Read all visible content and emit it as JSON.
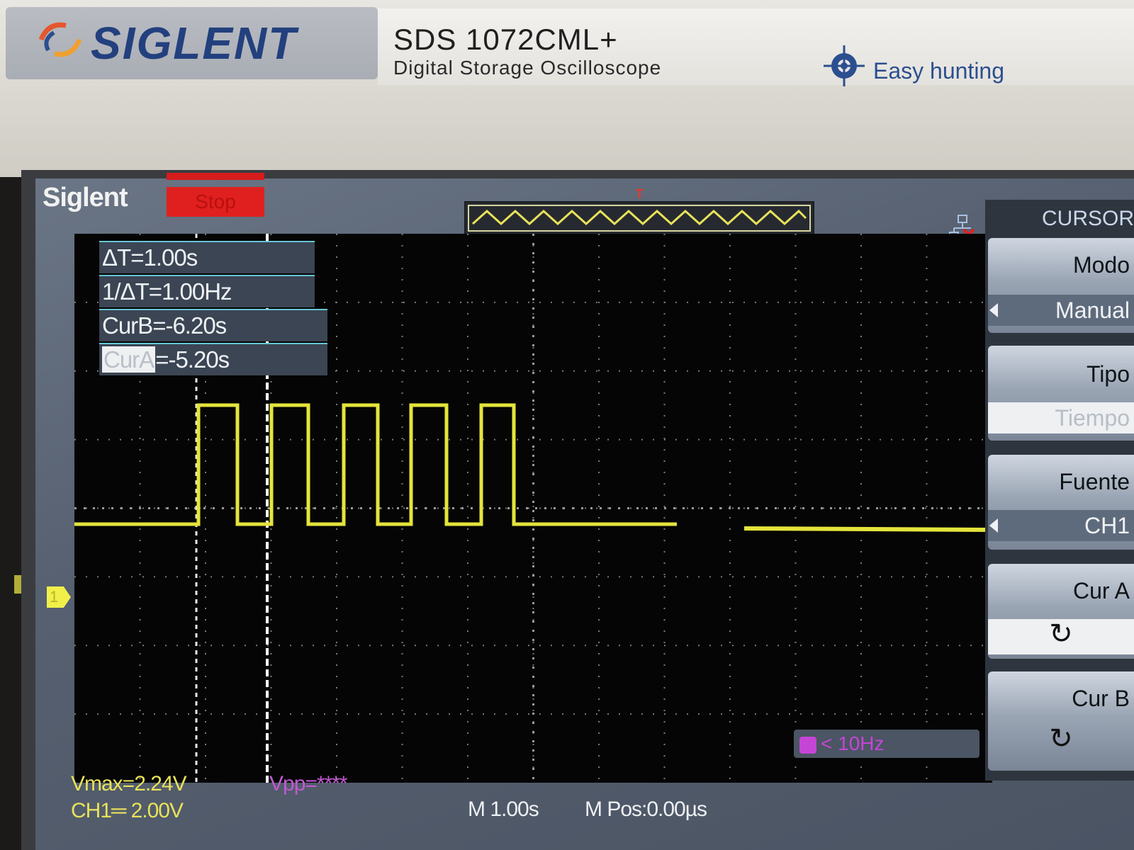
{
  "device": {
    "brand": "SIGLENT",
    "model": "SDS 1072CML+",
    "description": "Digital Storage Oscilloscope",
    "tagline": "Easy hunting"
  },
  "screen": {
    "logo": "Siglent",
    "run_state": "Stop",
    "trigger_marker": "T"
  },
  "measurements": {
    "delta_t": "ΔT=1.00s",
    "inv_delta_t": "1/ΔT=1.00Hz",
    "cur_b_label": "CurB",
    "cur_b_value": "=-6.20s",
    "cur_a_label": "CurA",
    "cur_a_value": "=-5.20s"
  },
  "channel": {
    "marker": "1",
    "color": "#e8e25a"
  },
  "frequency_readout": "< 10Hz",
  "status": {
    "vmax": "Vmax=2.24V",
    "vpp": "Vpp=****",
    "ch1_scale": "CH1═ 2.00V",
    "timebase": "M 1.00s",
    "position": "M Pos:0.00µs"
  },
  "menu": {
    "title": "CURSOR",
    "mode_label": "Modo",
    "mode_value": "Manual",
    "type_label": "Tipo",
    "type_value": "Tiempo",
    "source_label": "Fuente",
    "source_value": "CH1",
    "cur_a_label": "Cur A",
    "cur_b_label": "Cur B",
    "knob_icon": "rotate-knob-icon"
  }
}
